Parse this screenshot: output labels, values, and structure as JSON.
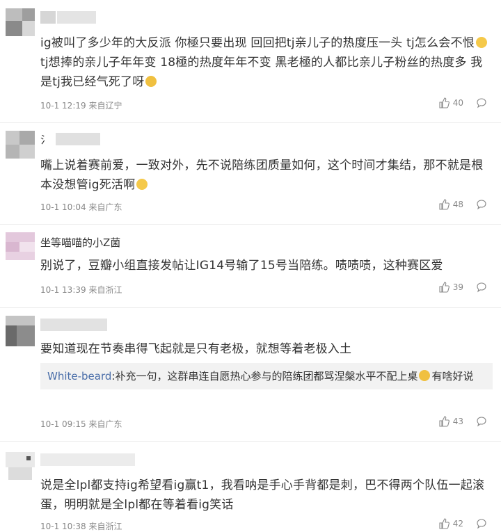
{
  "comments": [
    {
      "text": "ig被叫了多少年的大反派 你極只要出现 回回把tj亲儿子的热度压一头 tj怎么会不恨",
      "text2": " tj想捧的亲儿子年年变 18極的热度年年不变 黑老極的人都比亲儿子粉丝的热度多 我是tj我已经气死了呀",
      "meta": "10-1 12:19 来自辽宁",
      "likes": "40"
    },
    {
      "text": "嘴上说着赛前爱，一致对外，先不说陪练团质量如何，这个时间才集结，那不就是根本没想管ig死活啊",
      "meta": "10-1 10:04 来自广东",
      "likes": "48",
      "name": "氵"
    },
    {
      "name": "坐等喵喵的小Z菌",
      "text": "别说了，豆瓣小组直接发帖让IG14号输了15号当陪练。啧啧啧，这种赛区爱",
      "meta": "10-1 13:39 来自浙江",
      "likes": "39"
    },
    {
      "text": "要知道现在节奏串得飞起就是只有老极，就想等着老极入土",
      "reply_user": "White-beard",
      "reply_text": ":补充一句，这群串连自愿热心参与的陪练团都骂涅槃水平不配上桌",
      "reply_text2": "有啥好说",
      "meta": "10-1 09:15 来自广东",
      "likes": "43"
    },
    {
      "text": "说是全lpl都支持ig希望看ig赢t1，我看呐是手心手背都是刺，巴不得两个队伍一起滚蛋，明明就是全lpl都在等着看ig笑话",
      "meta": "10-1 10:38 来自浙江",
      "likes": "42"
    }
  ],
  "icons": {
    "like": "thumbs-up-icon",
    "comment": "comment-bubble-icon"
  },
  "colors": {
    "meta": "#888888",
    "reply_user": "#4a6ea9",
    "reply_bg": "#f2f2f2"
  }
}
